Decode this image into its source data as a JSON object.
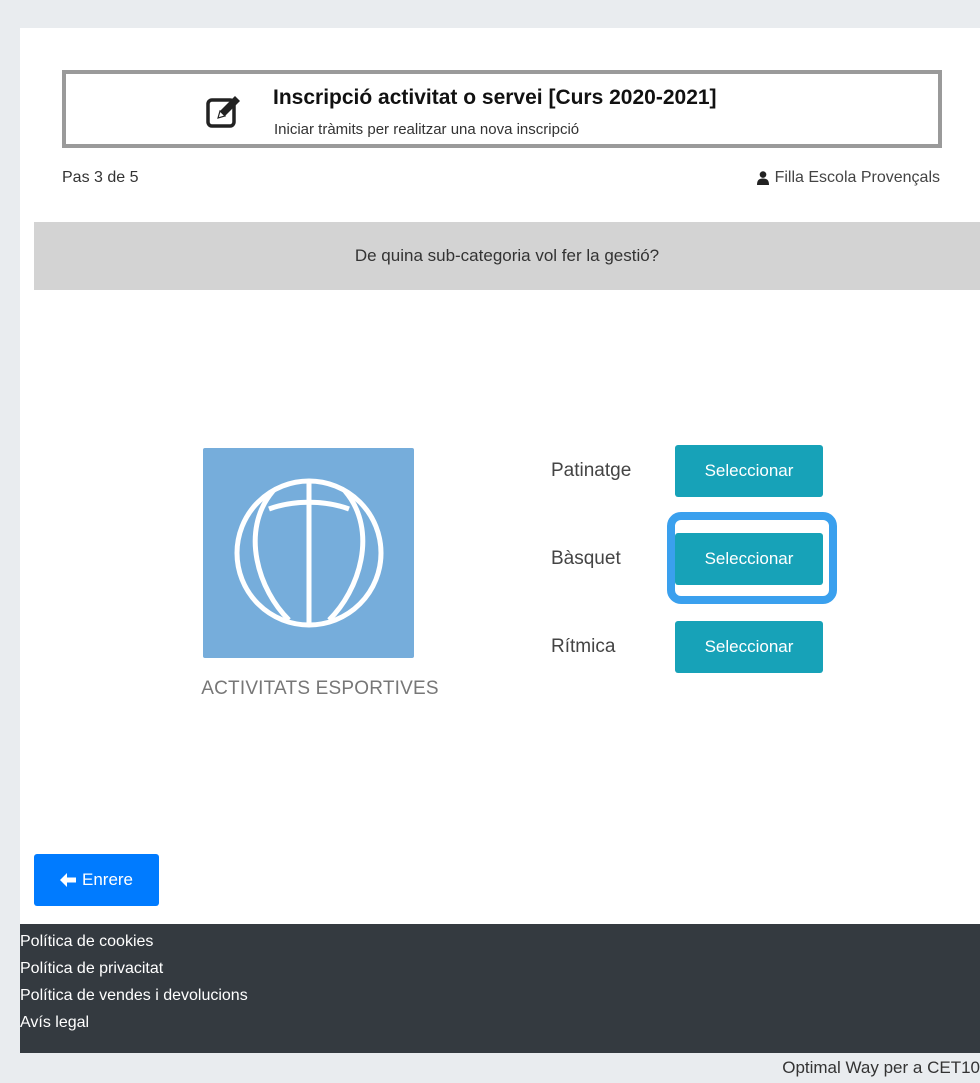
{
  "header": {
    "title": "Inscripció activitat o servei [Curs 2020-2021]",
    "subtitle": "Iniciar tràmits per realitzar una nova inscripció",
    "icon": "edit-icon"
  },
  "progress": {
    "step_text": "Pas 3 de 5"
  },
  "user": {
    "name": "Filla Escola Provençals",
    "icon": "user-icon"
  },
  "question": "De quina sub-categoria vol fer la gestió?",
  "category": {
    "name": "ACTIVITATS ESPORTIVES",
    "icon": "basketball-icon",
    "tile_color": "#76addb"
  },
  "options": [
    {
      "label": "Patinatge",
      "button": "Seleccionar"
    },
    {
      "label": "Bàsquet",
      "button": "Seleccionar",
      "highlighted": true
    },
    {
      "label": "Rítmica",
      "button": "Seleccionar"
    }
  ],
  "back_button": "Enrere",
  "footer": {
    "links": [
      "Política de cookies",
      "Política de privacitat",
      "Política de vendes i devolucions",
      "Avís legal"
    ]
  },
  "credit": "Optimal Way per a CET10",
  "colors": {
    "select_button": "#17a2b8",
    "back_button": "#007bff",
    "footer_bg": "#343a40",
    "highlight_ring": "#3aa0ee"
  }
}
